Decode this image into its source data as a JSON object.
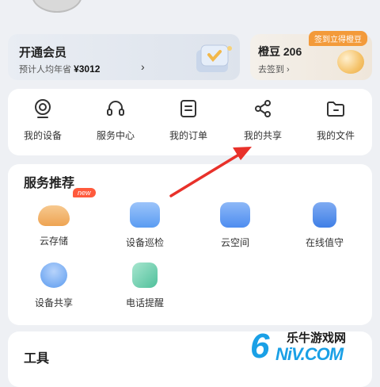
{
  "membership": {
    "title": "开通会员",
    "subtitle": "预计人均年省",
    "amount": "¥3012",
    "arrow": "›"
  },
  "beans": {
    "badge": "签到立得橙豆",
    "title": "橙豆 206",
    "subtitle": "去签到 ›"
  },
  "quick_actions": [
    {
      "label": "我的设备",
      "icon": "camera-icon"
    },
    {
      "label": "服务中心",
      "icon": "headset-icon"
    },
    {
      "label": "我的订单",
      "icon": "order-list-icon"
    },
    {
      "label": "我的共享",
      "icon": "share-icon"
    },
    {
      "label": "我的文件",
      "icon": "folder-icon"
    }
  ],
  "services": {
    "title": "服务推荐",
    "new_badge": "new",
    "items": [
      {
        "label": "云存储",
        "icon": "cloud-storage-icon",
        "color": "#f1b069"
      },
      {
        "label": "设备巡检",
        "icon": "device-inspect-icon",
        "color": "#5a9cf2"
      },
      {
        "label": "云空间",
        "icon": "cloud-space-icon",
        "color": "#4e8df0"
      },
      {
        "label": "在线值守",
        "icon": "online-guard-icon",
        "color": "#3f7fe6"
      },
      {
        "label": "设备共享",
        "icon": "device-share-icon",
        "color": "#5b9bef"
      },
      {
        "label": "电话提醒",
        "icon": "phone-alert-icon",
        "color": "#4fc09b"
      }
    ]
  },
  "tools": {
    "title": "工具"
  },
  "watermark": {
    "digit": "6",
    "brand": "乐牛游戏网",
    "url": "NiV.COM"
  },
  "colors": {
    "annotation_arrow": "#e8312a",
    "accent": "#1aa0e6"
  }
}
